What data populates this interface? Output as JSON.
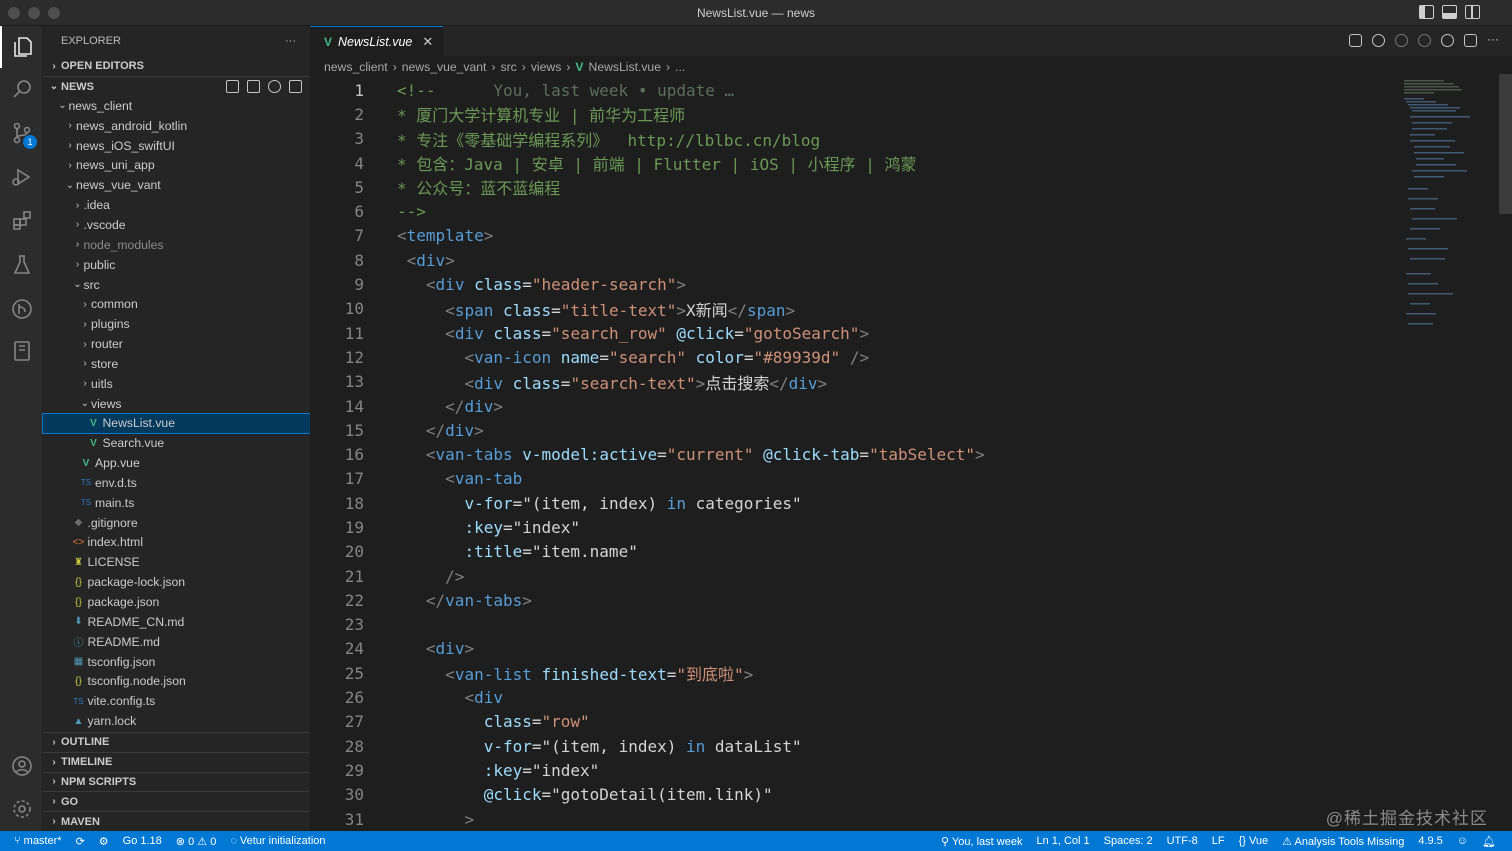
{
  "window": {
    "title": "NewsList.vue — news"
  },
  "activity": {
    "source_control_badge": "1"
  },
  "sidebar": {
    "title": "EXPLORER",
    "more": "···",
    "open_editors": "OPEN EDITORS",
    "root": "NEWS",
    "tree": [
      {
        "label": "news_client",
        "kind": "folder-open",
        "indent": 1
      },
      {
        "label": "news_android_kotlin",
        "kind": "folder",
        "indent": 2
      },
      {
        "label": "news_iOS_swiftUI",
        "kind": "folder",
        "indent": 2
      },
      {
        "label": "news_uni_app",
        "kind": "folder",
        "indent": 2
      },
      {
        "label": "news_vue_vant",
        "kind": "folder-open",
        "indent": 2
      },
      {
        "label": ".idea",
        "kind": "folder",
        "indent": 3
      },
      {
        "label": ".vscode",
        "kind": "folder",
        "indent": 3
      },
      {
        "label": "node_modules",
        "kind": "folder",
        "indent": 3,
        "dim": true
      },
      {
        "label": "public",
        "kind": "folder",
        "indent": 3
      },
      {
        "label": "src",
        "kind": "folder-open",
        "indent": 3
      },
      {
        "label": "common",
        "kind": "folder",
        "indent": 4
      },
      {
        "label": "plugins",
        "kind": "folder",
        "indent": 4
      },
      {
        "label": "router",
        "kind": "folder",
        "indent": 4
      },
      {
        "label": "store",
        "kind": "folder",
        "indent": 4
      },
      {
        "label": "uitls",
        "kind": "folder",
        "indent": 4
      },
      {
        "label": "views",
        "kind": "folder-open",
        "indent": 4
      },
      {
        "label": "NewsList.vue",
        "kind": "vue",
        "indent": 5,
        "selected": true
      },
      {
        "label": "Search.vue",
        "kind": "vue",
        "indent": 5
      },
      {
        "label": "App.vue",
        "kind": "vue",
        "indent": 4
      },
      {
        "label": "env.d.ts",
        "kind": "ts",
        "indent": 4
      },
      {
        "label": "main.ts",
        "kind": "ts",
        "indent": 4
      },
      {
        "label": ".gitignore",
        "kind": "git",
        "indent": 3
      },
      {
        "label": "index.html",
        "kind": "html",
        "indent": 3
      },
      {
        "label": "LICENSE",
        "kind": "license",
        "indent": 3
      },
      {
        "label": "package-lock.json",
        "kind": "json",
        "indent": 3
      },
      {
        "label": "package.json",
        "kind": "json",
        "indent": 3
      },
      {
        "label": "README_CN.md",
        "kind": "md",
        "indent": 3
      },
      {
        "label": "README.md",
        "kind": "info",
        "indent": 3
      },
      {
        "label": "tsconfig.json",
        "kind": "tsconfig",
        "indent": 3
      },
      {
        "label": "tsconfig.node.json",
        "kind": "json",
        "indent": 3
      },
      {
        "label": "vite.config.ts",
        "kind": "ts",
        "indent": 3
      },
      {
        "label": "yarn.lock",
        "kind": "yarn",
        "indent": 3
      }
    ],
    "bottom_sections": [
      "OUTLINE",
      "TIMELINE",
      "NPM SCRIPTS",
      "GO",
      "MAVEN"
    ]
  },
  "editor": {
    "tab": {
      "icon": "V",
      "label": "NewsList.vue",
      "close": "✕"
    },
    "breadcrumb": [
      "news_client",
      "news_vue_vant",
      "src",
      "views",
      "NewsList.vue",
      "..."
    ],
    "lines": [
      [
        [
          "cmt",
          "<!--"
        ],
        [
          "ghost",
          "      You, last week • update …"
        ]
      ],
      [
        [
          "cmt",
          "* 厦门大学计算机专业 | 前华为工程师"
        ]
      ],
      [
        [
          "cmt",
          "* 专注《零基础学编程系列》  http://lblbc.cn/blog"
        ]
      ],
      [
        [
          "cmt",
          "* 包含：Java | 安卓 | 前端 | Flutter | iOS | 小程序 | 鸿蒙"
        ]
      ],
      [
        [
          "cmt",
          "* 公众号：蓝不蓝编程"
        ]
      ],
      [
        [
          "cmt",
          "-->"
        ]
      ],
      [
        [
          "tagp",
          "<"
        ],
        [
          "tag",
          "template"
        ],
        [
          "tagp",
          ">"
        ]
      ],
      [
        [
          "plain",
          " "
        ],
        [
          "tagp",
          "<"
        ],
        [
          "tag",
          "div"
        ],
        [
          "tagp",
          ">"
        ]
      ],
      [
        [
          "plain",
          "   "
        ],
        [
          "tagp",
          "<"
        ],
        [
          "tag",
          "div"
        ],
        [
          "plain",
          " "
        ],
        [
          "attr",
          "class"
        ],
        [
          "plain",
          "="
        ],
        [
          "str",
          "\"header-search\""
        ],
        [
          "tagp",
          ">"
        ]
      ],
      [
        [
          "plain",
          "     "
        ],
        [
          "tagp",
          "<"
        ],
        [
          "tag",
          "span"
        ],
        [
          "plain",
          " "
        ],
        [
          "attr",
          "class"
        ],
        [
          "plain",
          "="
        ],
        [
          "str",
          "\"title-text\""
        ],
        [
          "tagp",
          ">"
        ],
        [
          "plain",
          "X新闻"
        ],
        [
          "tagp",
          "</"
        ],
        [
          "tag",
          "span"
        ],
        [
          "tagp",
          ">"
        ]
      ],
      [
        [
          "plain",
          "     "
        ],
        [
          "tagp",
          "<"
        ],
        [
          "tag",
          "div"
        ],
        [
          "plain",
          " "
        ],
        [
          "attr",
          "class"
        ],
        [
          "plain",
          "="
        ],
        [
          "str",
          "\"search_row\""
        ],
        [
          "plain",
          " "
        ],
        [
          "attr",
          "@click"
        ],
        [
          "plain",
          "="
        ],
        [
          "str",
          "\"gotoSearch\""
        ],
        [
          "tagp",
          ">"
        ]
      ],
      [
        [
          "plain",
          "       "
        ],
        [
          "tagp",
          "<"
        ],
        [
          "tag",
          "van-icon"
        ],
        [
          "plain",
          " "
        ],
        [
          "attr",
          "name"
        ],
        [
          "plain",
          "="
        ],
        [
          "str",
          "\"search\""
        ],
        [
          "plain",
          " "
        ],
        [
          "attr",
          "color"
        ],
        [
          "plain",
          "="
        ],
        [
          "str",
          "\"#89939d\""
        ],
        [
          "plain",
          " "
        ],
        [
          "tagp",
          "/>"
        ]
      ],
      [
        [
          "plain",
          "       "
        ],
        [
          "tagp",
          "<"
        ],
        [
          "tag",
          "div"
        ],
        [
          "plain",
          " "
        ],
        [
          "attr",
          "class"
        ],
        [
          "plain",
          "="
        ],
        [
          "str",
          "\"search-text\""
        ],
        [
          "tagp",
          ">"
        ],
        [
          "plain",
          "点击搜索"
        ],
        [
          "tagp",
          "</"
        ],
        [
          "tag",
          "div"
        ],
        [
          "tagp",
          ">"
        ]
      ],
      [
        [
          "plain",
          "     "
        ],
        [
          "tagp",
          "</"
        ],
        [
          "tag",
          "div"
        ],
        [
          "tagp",
          ">"
        ]
      ],
      [
        [
          "plain",
          "   "
        ],
        [
          "tagp",
          "</"
        ],
        [
          "tag",
          "div"
        ],
        [
          "tagp",
          ">"
        ]
      ],
      [
        [
          "plain",
          "   "
        ],
        [
          "tagp",
          "<"
        ],
        [
          "tag",
          "van-tabs"
        ],
        [
          "plain",
          " "
        ],
        [
          "attr",
          "v-model:active"
        ],
        [
          "plain",
          "="
        ],
        [
          "str",
          "\"current\""
        ],
        [
          "plain",
          " "
        ],
        [
          "attr",
          "@click-tab"
        ],
        [
          "plain",
          "="
        ],
        [
          "str",
          "\"tabSelect\""
        ],
        [
          "tagp",
          ">"
        ]
      ],
      [
        [
          "plain",
          "     "
        ],
        [
          "tagp",
          "<"
        ],
        [
          "tag",
          "van-tab"
        ]
      ],
      [
        [
          "plain",
          "       "
        ],
        [
          "attr",
          "v-for"
        ],
        [
          "plain",
          "=\""
        ],
        [
          "plain",
          "(item, index) "
        ],
        [
          "kw",
          "in"
        ],
        [
          "plain",
          " categories\""
        ]
      ],
      [
        [
          "plain",
          "       "
        ],
        [
          "attr",
          ":key"
        ],
        [
          "plain",
          "=\"index\""
        ]
      ],
      [
        [
          "plain",
          "       "
        ],
        [
          "attr",
          ":title"
        ],
        [
          "plain",
          "=\"item.name\""
        ]
      ],
      [
        [
          "plain",
          "     "
        ],
        [
          "tagp",
          "/>"
        ]
      ],
      [
        [
          "plain",
          "   "
        ],
        [
          "tagp",
          "</"
        ],
        [
          "tag",
          "van-tabs"
        ],
        [
          "tagp",
          ">"
        ]
      ],
      [
        [
          "plain",
          ""
        ]
      ],
      [
        [
          "plain",
          "   "
        ],
        [
          "tagp",
          "<"
        ],
        [
          "tag",
          "div"
        ],
        [
          "tagp",
          ">"
        ]
      ],
      [
        [
          "plain",
          "     "
        ],
        [
          "tagp",
          "<"
        ],
        [
          "tag",
          "van-list"
        ],
        [
          "plain",
          " "
        ],
        [
          "attr",
          "finished-text"
        ],
        [
          "plain",
          "="
        ],
        [
          "str",
          "\"到底啦\""
        ],
        [
          "tagp",
          ">"
        ]
      ],
      [
        [
          "plain",
          "       "
        ],
        [
          "tagp",
          "<"
        ],
        [
          "tag",
          "div"
        ]
      ],
      [
        [
          "plain",
          "         "
        ],
        [
          "attr",
          "class"
        ],
        [
          "plain",
          "="
        ],
        [
          "str",
          "\"row\""
        ]
      ],
      [
        [
          "plain",
          "         "
        ],
        [
          "attr",
          "v-for"
        ],
        [
          "plain",
          "=\"(item, index) "
        ],
        [
          "kw",
          "in"
        ],
        [
          "plain",
          " dataList\""
        ]
      ],
      [
        [
          "plain",
          "         "
        ],
        [
          "attr",
          ":key"
        ],
        [
          "plain",
          "=\"index\""
        ]
      ],
      [
        [
          "plain",
          "         "
        ],
        [
          "attr",
          "@click"
        ],
        [
          "plain",
          "=\"gotoDetail(item.link)\""
        ]
      ],
      [
        [
          "plain",
          "       "
        ],
        [
          "tagp",
          ">"
        ]
      ]
    ]
  },
  "statusbar": {
    "branch": "master*",
    "go": "Go 1.18",
    "errors": "0",
    "warnings": "0",
    "vetur": "Vetur initialization",
    "blame": "You, last week",
    "position": "Ln 1, Col 1",
    "spaces": "Spaces: 2",
    "encoding": "UTF-8",
    "eol": "LF",
    "language": "Vue",
    "analysis": "Analysis Tools Missing",
    "version": "4.9.5"
  },
  "watermark": "@稀土掘金技术社区"
}
